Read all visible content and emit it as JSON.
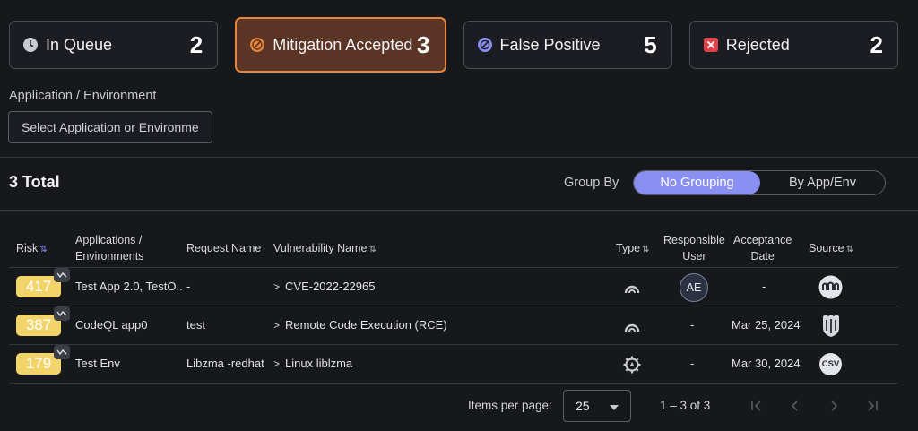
{
  "status_cards": [
    {
      "label": "In Queue",
      "count": "2",
      "icon": "clock-icon"
    },
    {
      "label": "Mitigation Accepted",
      "count": "3",
      "icon": "no-bug-icon"
    },
    {
      "label": "False Positive",
      "count": "5",
      "icon": "false-positive-icon"
    },
    {
      "label": "Rejected",
      "count": "2",
      "icon": "close-icon"
    }
  ],
  "filter": {
    "label": "Application / Environment",
    "placeholder": "Select Application or Environment"
  },
  "summary": {
    "total": "3 Total",
    "group_by_label": "Group By",
    "options": [
      "No Grouping",
      "By App/Env"
    ],
    "selected": "No Grouping"
  },
  "table": {
    "headers": {
      "risk": "Risk",
      "applications_line1": "Applications /",
      "applications_line2": "Environments",
      "request_name": "Request Name",
      "vulnerability_name": "Vulnerability Name",
      "type": "Type",
      "responsible_line1": "Responsible",
      "responsible_line2": "User",
      "acceptance_line1": "Acceptance",
      "acceptance_line2": "Date",
      "source": "Source"
    },
    "rows": [
      {
        "risk": "417",
        "application": "Test App 2.0, TestO...",
        "request": "-",
        "vulnerability": "CVE-2022-22965",
        "type_icon": "arch-icon",
        "user": "AE",
        "date": "-",
        "source_icon": "waves-logo-icon"
      },
      {
        "risk": "387",
        "application": "CodeQL app0",
        "request": "test",
        "vulnerability": "Remote Code Execution (RCE)",
        "type_icon": "arch-icon",
        "user": "-",
        "date": "Mar 25, 2024",
        "source_icon": "shield-logo-icon"
      },
      {
        "risk": "179",
        "application": "Test Env",
        "request": "Libzma -redhat",
        "vulnerability": "Linux liblzma",
        "type_icon": "gear-icon",
        "user": "-",
        "date": "Mar 30, 2024",
        "source_icon": "csv-icon",
        "source_label": "CSV"
      }
    ]
  },
  "pagination": {
    "items_per_page_label": "Items per page:",
    "page_size": "25",
    "range": "1 – 3 of 3"
  },
  "colors": {
    "accent": "#8a8ff2",
    "active_card_border": "#e8863c",
    "risk_badge": "#f3d46a"
  }
}
